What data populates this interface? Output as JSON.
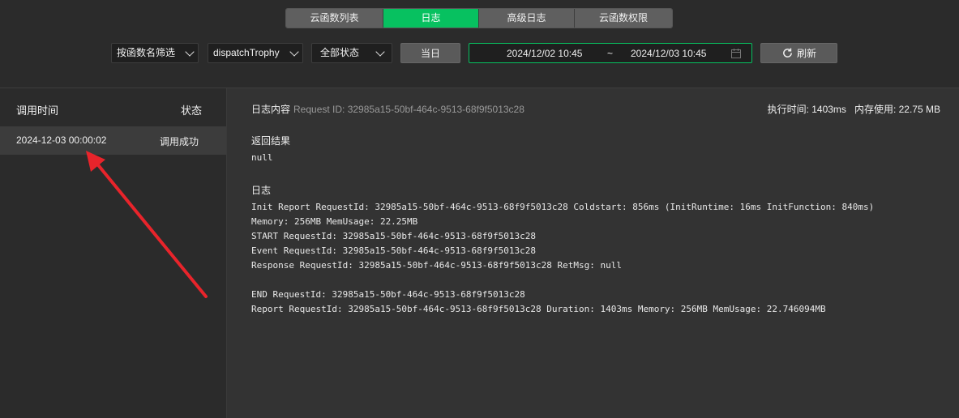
{
  "tabs": [
    "云函数列表",
    "日志",
    "高级日志",
    "云函数权限"
  ],
  "filters": {
    "function_filter": "按函数名筛选",
    "function_name": "dispatchTrophy",
    "status": "全部状态",
    "today_label": "当日",
    "date_start": "2024/12/02 10:45",
    "date_sep": "~",
    "date_end": "2024/12/03 10:45",
    "refresh_label": "刷新"
  },
  "list": {
    "col_time": "调用时间",
    "col_status": "状态",
    "rows": [
      {
        "time": "2024-12-03 00:00:02",
        "status": "调用成功"
      }
    ]
  },
  "detail": {
    "title": "日志内容",
    "request_id": "Request ID: 32985a15-50bf-464c-9513-68f9f5013c28",
    "exec_time": "执行时间: 1403ms",
    "memory": "内存使用: 22.75 MB",
    "return_label": "返回结果",
    "return_value": "null",
    "log_label": "日志",
    "log_lines": [
      "Init Report RequestId: 32985a15-50bf-464c-9513-68f9f5013c28 Coldstart: 856ms (InitRuntime: 16ms InitFunction: 840ms)",
      "Memory: 256MB MemUsage: 22.25MB",
      "START RequestId: 32985a15-50bf-464c-9513-68f9f5013c28",
      "Event RequestId: 32985a15-50bf-464c-9513-68f9f5013c28",
      "Response RequestId: 32985a15-50bf-464c-9513-68f9f5013c28 RetMsg: null",
      "",
      "END RequestId: 32985a15-50bf-464c-9513-68f9f5013c28",
      "Report RequestId: 32985a15-50bf-464c-9513-68f9f5013c28 Duration: 1403ms Memory: 256MB MemUsage: 22.746094MB"
    ]
  },
  "colors": {
    "accent": "#07c160",
    "annotation": "#e8242b"
  },
  "icons": {
    "calendar": "calendar-icon",
    "refresh": "refresh-icon",
    "chevron": "chevron-down-icon"
  }
}
